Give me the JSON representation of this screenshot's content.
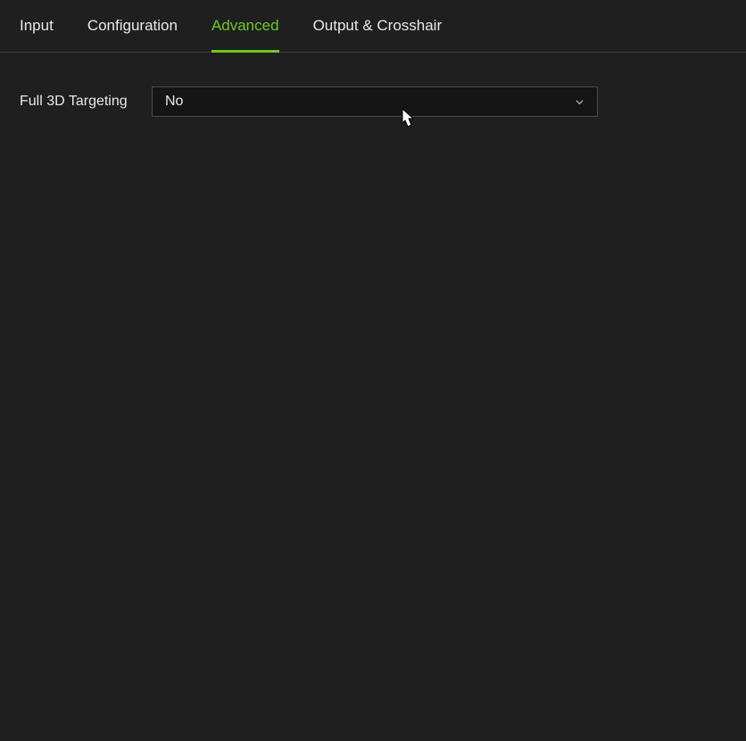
{
  "tabs": {
    "input": "Input",
    "configuration": "Configuration",
    "advanced": "Advanced",
    "output_crosshair": "Output & Crosshair"
  },
  "settings": {
    "full_3d_targeting": {
      "label": "Full 3D Targeting",
      "value": "No"
    }
  }
}
